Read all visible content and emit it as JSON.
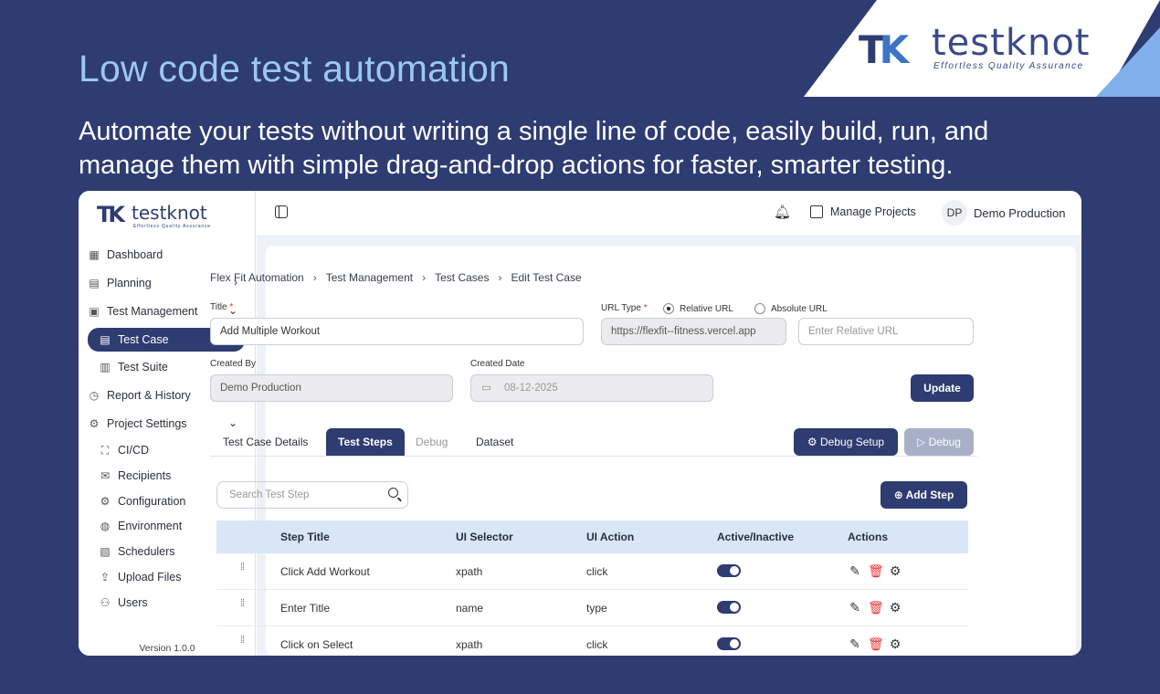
{
  "hero": {
    "title": "Low code test automation",
    "subtitle": "Automate your tests without writing a single line of code, easily build, run, and manage them with simple drag-and-drop actions for faster, smarter testing."
  },
  "brand": {
    "name": "testknot",
    "tagline": "Effortless Quality Assurance"
  },
  "sidebar": {
    "items": [
      {
        "label": "Dashboard",
        "icon": "grid-icon"
      },
      {
        "label": "Planning",
        "icon": "calendar-icon"
      },
      {
        "label": "Test Management",
        "icon": "clipboard-icon"
      },
      {
        "label": "Test Case",
        "icon": "document-icon"
      },
      {
        "label": "Test Suite",
        "icon": "list-icon"
      },
      {
        "label": "Report & History",
        "icon": "clock-icon"
      },
      {
        "label": "Project Settings",
        "icon": "gear-icon"
      },
      {
        "label": "CI/CD",
        "icon": "expand-icon"
      },
      {
        "label": "Recipients",
        "icon": "mail-icon"
      },
      {
        "label": "Configuration",
        "icon": "gear-icon"
      },
      {
        "label": "Environment",
        "icon": "globe-icon"
      },
      {
        "label": "Schedulers",
        "icon": "schedule-icon"
      },
      {
        "label": "Upload Files",
        "icon": "upload-icon"
      },
      {
        "label": "Users",
        "icon": "users-icon"
      }
    ],
    "version": "Version 1.0.0"
  },
  "topbar": {
    "manage_projects": "Manage Projects",
    "avatar_initials": "DP",
    "user_name": "Demo Production"
  },
  "breadcrumb": [
    "Flex Fit Automation",
    "Test Management",
    "Test Cases",
    "Edit Test Case"
  ],
  "form": {
    "title_label": "Title",
    "title_value": "Add Multiple Workout",
    "url_type_label": "URL Type",
    "url_type_options": [
      "Relative URL",
      "Absolute URL"
    ],
    "url_type_selected": "Relative URL",
    "base_url": "https://flexfit--fitness.vercel.app",
    "relative_url_placeholder": "Enter Relative URL",
    "created_by_label": "Created By",
    "created_by_value": "Demo Production",
    "created_date_label": "Created Date",
    "created_date_value": "08-12-2025",
    "update_label": "Update"
  },
  "tabs": [
    "Test Case Details",
    "Test Steps",
    "Debug",
    "Dataset"
  ],
  "active_tab": "Test Steps",
  "debug_setup_label": "Debug Setup",
  "debug_label": "Debug",
  "search_placeholder": "Search Test Step",
  "add_step_label": "Add Step",
  "table": {
    "headers": [
      "Step Title",
      "UI Selector",
      "UI Action",
      "Active/Inactive",
      "Actions"
    ],
    "rows": [
      {
        "title": "Click Add Workout",
        "selector": "xpath",
        "action": "click",
        "active": true
      },
      {
        "title": "Enter Title",
        "selector": "name",
        "action": "type",
        "active": true
      },
      {
        "title": "Click on Select",
        "selector": "xpath",
        "action": "click",
        "active": true
      }
    ]
  },
  "colors": {
    "background": "#2e3c72",
    "accent": "#2e3c72",
    "hero_title": "#9cc7f5",
    "table_header": "#d8e6f8",
    "delete": "#e33333"
  }
}
